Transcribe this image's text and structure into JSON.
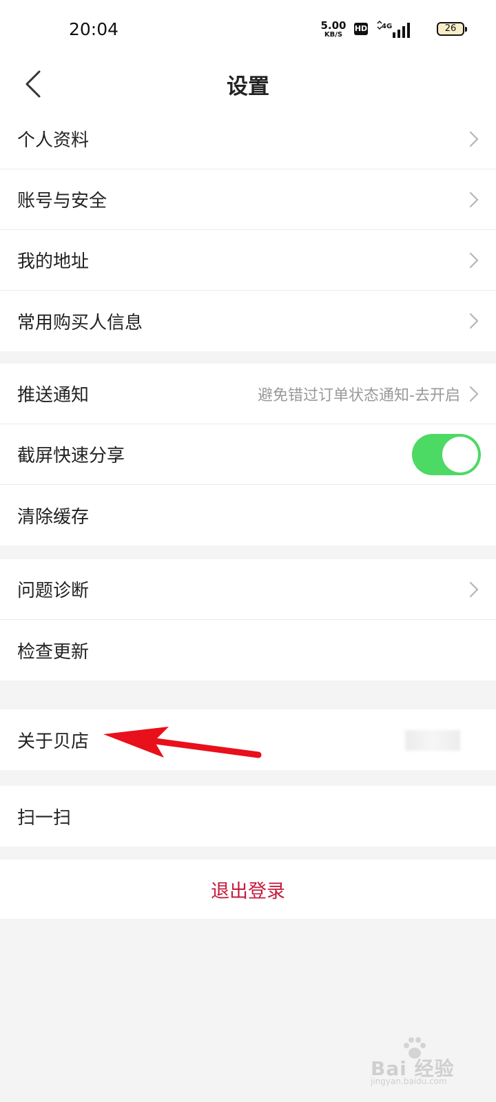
{
  "status_bar": {
    "time": "20:04",
    "net_speed_value": "5.00",
    "net_speed_unit": "KB/S",
    "hd_badge": "HD",
    "network_type": "4G",
    "battery": "26"
  },
  "header": {
    "title": "设置",
    "back_icon": "chevron-left-icon"
  },
  "groups": [
    {
      "items": [
        {
          "label": "个人资料",
          "chevron": true
        },
        {
          "label": "账号与安全",
          "chevron": true
        },
        {
          "label": "我的地址",
          "chevron": true
        },
        {
          "label": "常用购买人信息",
          "chevron": true
        }
      ]
    },
    {
      "items": [
        {
          "label": "推送通知",
          "value": "避免错过订单状态通知-去开启",
          "chevron": true
        },
        {
          "label": "截屏快速分享",
          "toggle": "on"
        },
        {
          "label": "清除缓存"
        }
      ]
    },
    {
      "items": [
        {
          "label": "问题诊断",
          "chevron": true
        },
        {
          "label": "检查更新"
        }
      ]
    },
    {
      "items": [
        {
          "label": "关于贝店",
          "value_blurred": true
        }
      ]
    },
    {
      "items": [
        {
          "label": "扫一扫"
        }
      ]
    }
  ],
  "logout": {
    "label": "退出登录",
    "color": "#c51a3c"
  },
  "colors": {
    "toggle_on": "#4cd964",
    "annotation_arrow": "#e8101a"
  },
  "watermark": {
    "brand": "Bai 经验",
    "url": "jingyan.baidu.com"
  }
}
